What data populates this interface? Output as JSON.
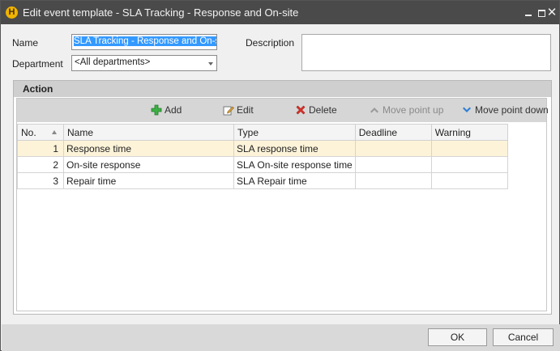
{
  "window": {
    "title": "Edit event template - SLA Tracking - Response and On-site",
    "icon": "app-logo-icon",
    "controls": {
      "minimize": "minimize-icon",
      "maximize": "maximize-icon",
      "close": "✕"
    }
  },
  "form": {
    "name_label": "Name",
    "name_value": "SLA Tracking - Response and On-site",
    "department_label": "Department",
    "department_value": "<All departments>",
    "description_label": "Description",
    "description_value": ""
  },
  "action": {
    "header": "Action",
    "toolbar": {
      "add": "Add",
      "edit": "Edit",
      "delete": "Delete",
      "move_up": "Move point up",
      "move_down": "Move point down"
    },
    "columns": [
      "No.",
      "Name",
      "Type",
      "Deadline",
      "Warning"
    ],
    "rows": [
      {
        "no": "1",
        "name": "Response time",
        "type": "SLA response time",
        "deadline": "",
        "warning": ""
      },
      {
        "no": "2",
        "name": "On-site response",
        "type": "SLA On-site response time",
        "deadline": "",
        "warning": ""
      },
      {
        "no": "3",
        "name": "Repair time",
        "type": "SLA Repair time",
        "deadline": "",
        "warning": ""
      }
    ],
    "selected_row": 0
  },
  "buttons": {
    "ok": "OK",
    "cancel": "Cancel"
  },
  "colors": {
    "titlebar": "#4a4a4a",
    "selection": "#3399ff",
    "selected_row": "#fdf3d9",
    "add_icon": "#3cb043",
    "delete_icon": "#e0342b",
    "move_down_icon": "#2f7fd6"
  }
}
